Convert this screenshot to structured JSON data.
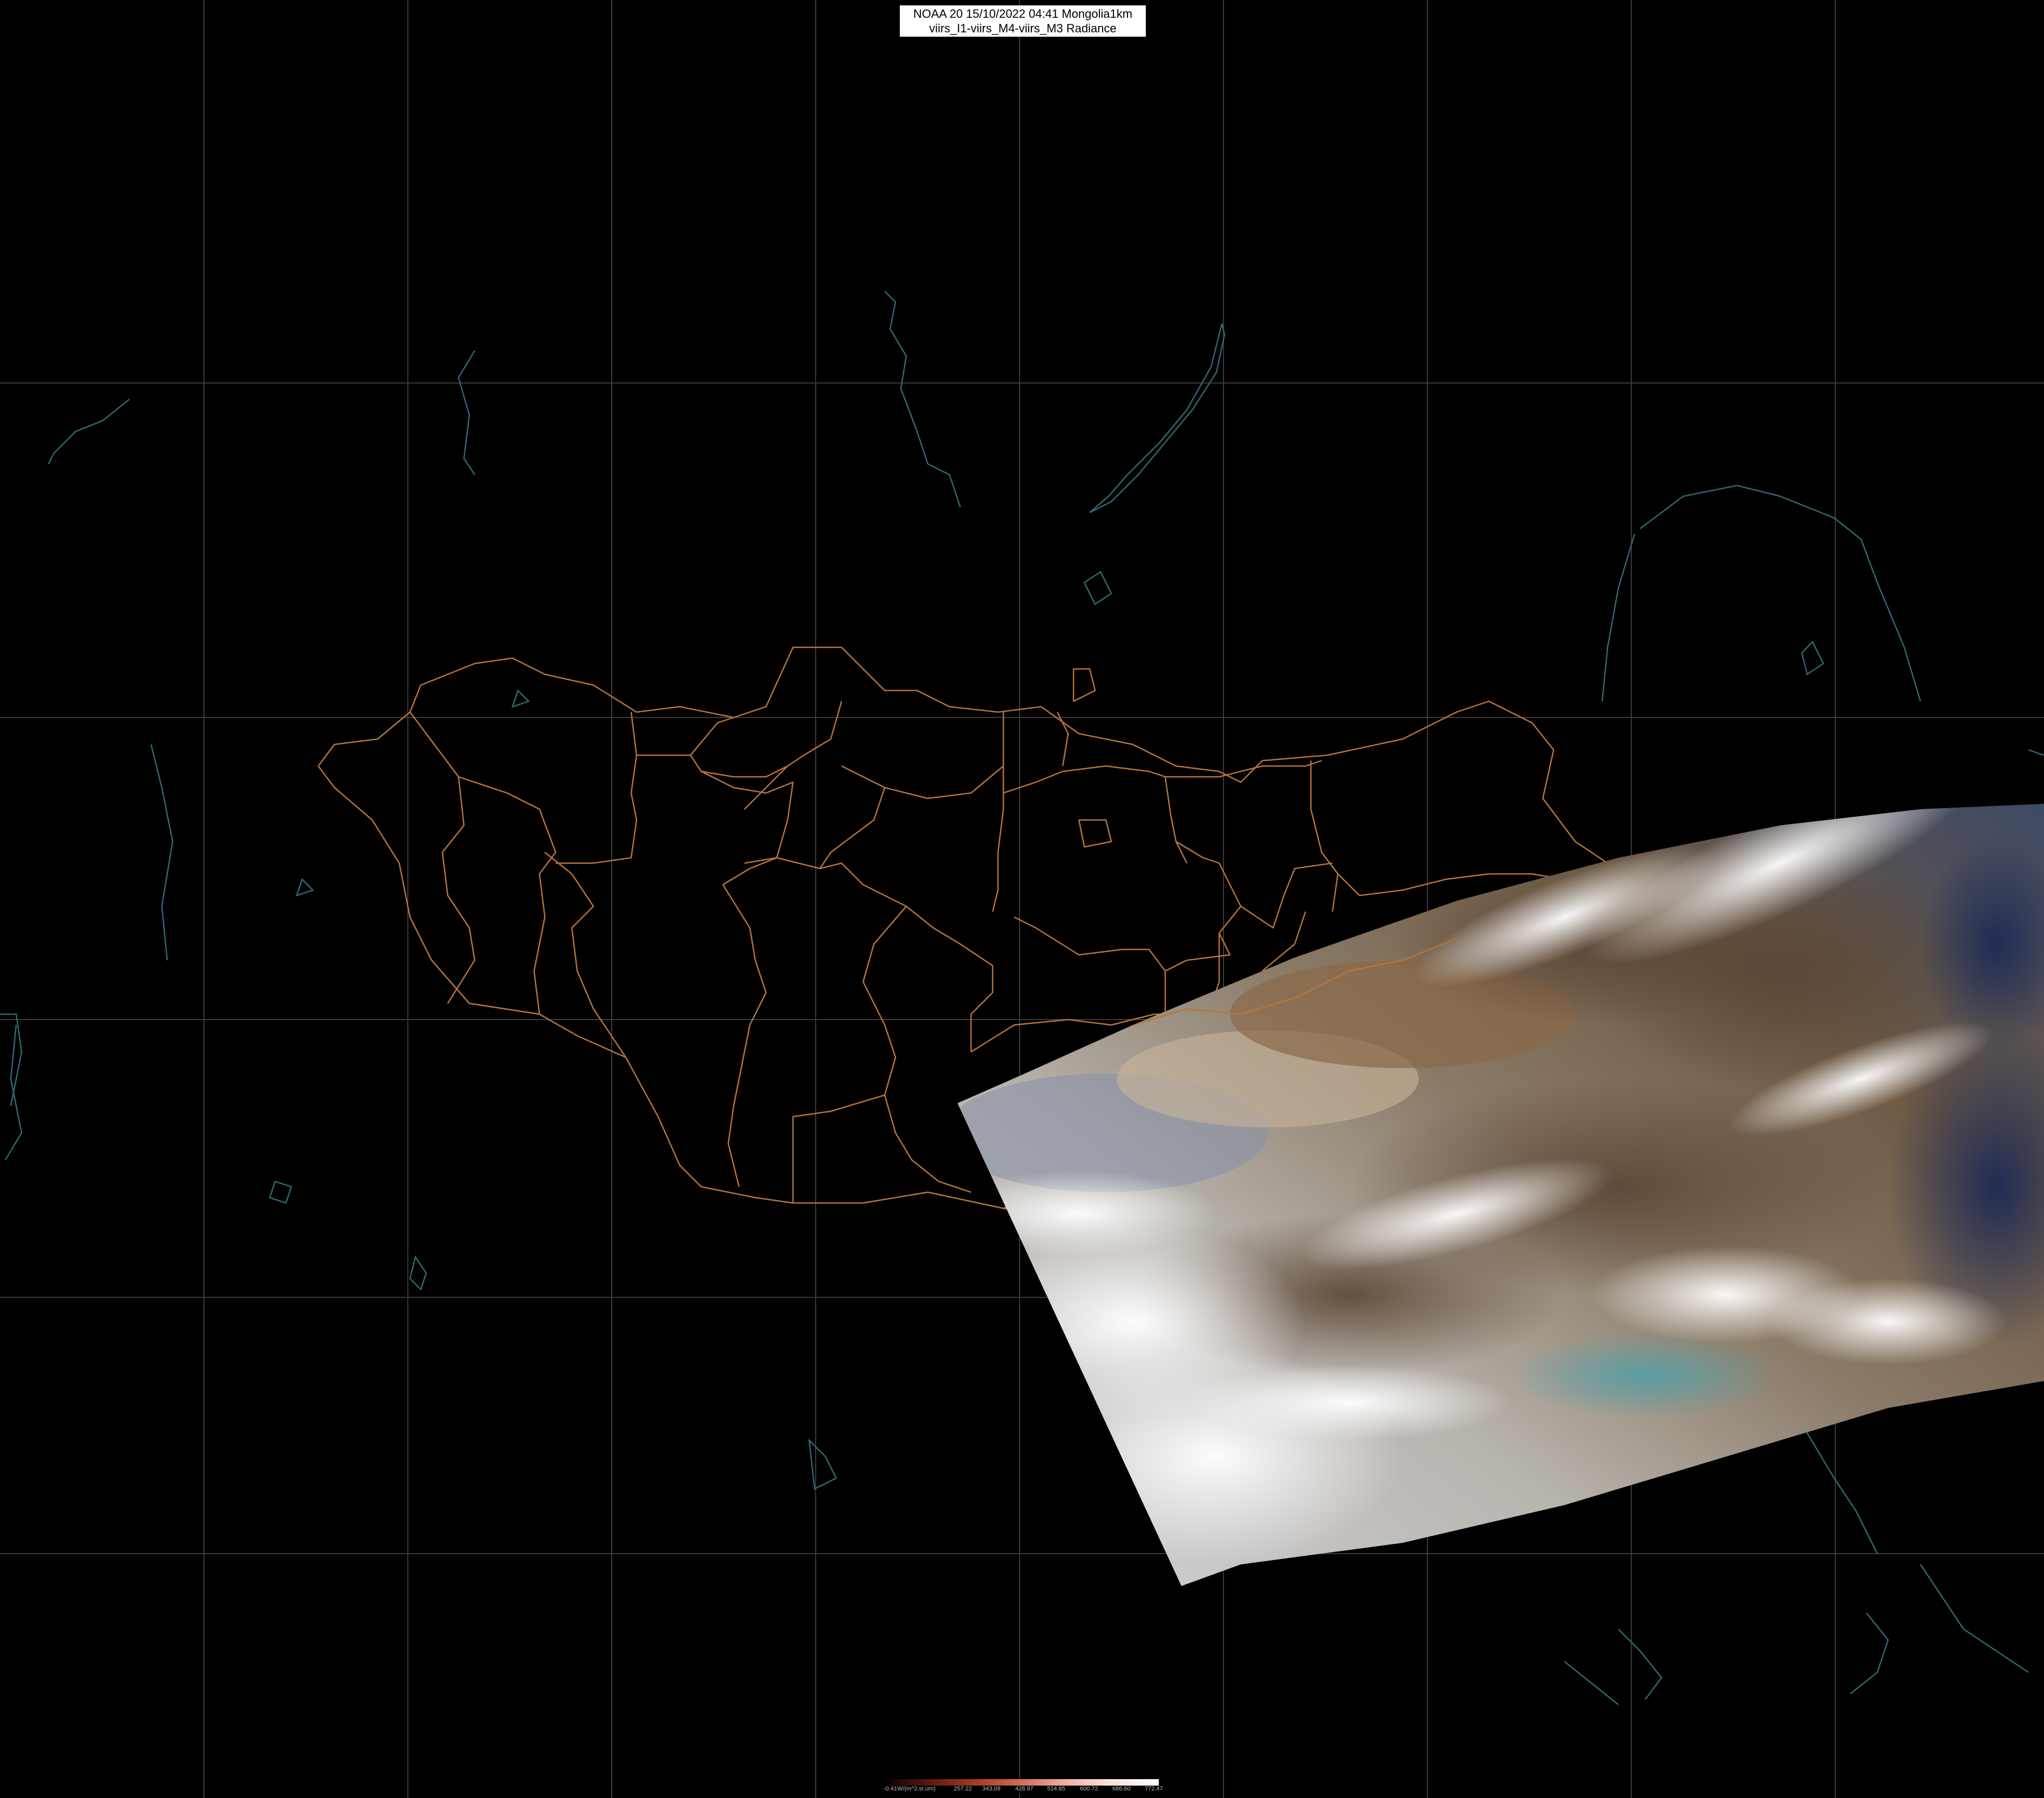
{
  "header": {
    "line1": "NOAA 20 15/10/2022 04:41 Mongolia1km",
    "line2": "viirs_I1-viirs_M4-viirs_M3 Radiance"
  },
  "legend": {
    "ticks": [
      "-0.41W/(m^2.sr.um)",
      "257.22",
      "343.09",
      "428.97",
      "514.85",
      "600.72",
      "686.60",
      "772.47"
    ],
    "colors": [
      "#000000",
      "#5a1a10",
      "#a23a28",
      "#d06a5a",
      "#f2b0a8",
      "#fbe2dc",
      "#ffffff"
    ]
  },
  "colors": {
    "background": "#000000",
    "graticule": "#3a3a3a",
    "coastline": "#2f6a70",
    "borders": "#b8743a"
  }
}
